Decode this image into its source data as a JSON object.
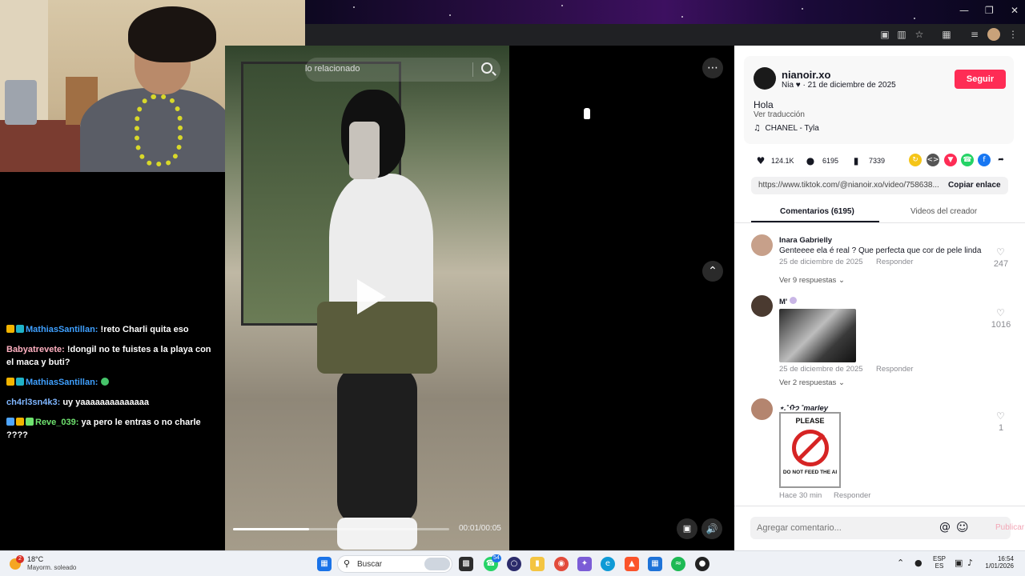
{
  "video_search": {
    "placeholder": "lo relacionado"
  },
  "video": {
    "time": "00:01/00:05",
    "progress": 0.35
  },
  "chat": {
    "messages": [
      {
        "user": "MathiasSantillan:",
        "text": "!reto Charli quita eso",
        "color": "#3fa0ff"
      },
      {
        "user": "Babyatrevete:",
        "text": "!dongil no te fuistes a la playa con el maca y buti?",
        "color": "#ffb0c0"
      },
      {
        "user": "MathiasSantillan:",
        "text": "",
        "color": "#3fa0ff"
      },
      {
        "user": "ch4rl3sn4k3:",
        "text": "uy yaaaaaaaaaaaaaa",
        "color": "#7fb6ff"
      },
      {
        "user": "Reve_039:",
        "text": "ya pero le entras o no charle ????",
        "color": "#6fe36f"
      }
    ]
  },
  "post": {
    "username": "nianoir.xo",
    "display_name": "Nia",
    "date": "21 de diciembre de 2025",
    "follow_label": "Seguir",
    "description": "Hola",
    "translate_label": "Ver traducción",
    "music": "CHANEL - Tyla",
    "likes": "124.1K",
    "comments": "6195",
    "saves": "7339",
    "link": "https://www.tiktok.com/@nianoir.xo/video/758638...",
    "copy_label": "Copiar enlace"
  },
  "tabs": {
    "comments": "Comentarios (6195)",
    "creator_videos": "Videos del creador"
  },
  "comments": [
    {
      "author": "Inara Gabrielly",
      "text": "Genteeee ela é real ? Que perfecta que cor de pele linda",
      "date": "25 de diciembre de 2025",
      "reply": "Responder",
      "likes": "247",
      "more": "Ver 9 respuestas"
    },
    {
      "author": "M'",
      "text": "",
      "date": "25 de diciembre de 2025",
      "reply": "Responder",
      "likes": "1016",
      "more": "Ver 2 respuestas"
    },
    {
      "author": "⋆.˚ᡣ𐭩 ˚marley",
      "text": "",
      "date": "Hace 30 min",
      "reply": "Responder",
      "likes": "1",
      "more": ""
    }
  ],
  "sticker": {
    "top": "PLEASE",
    "bottom": "DO NOT FEED THE AI"
  },
  "comment_input": {
    "placeholder": "Agregar comentario...",
    "publish": "Publicar"
  },
  "taskbar": {
    "weather_temp": "18°C",
    "weather_desc": "Mayorm. soleado",
    "search_label": "Buscar",
    "lang_top": "ESP",
    "lang_bottom": "ES",
    "time": "16:54",
    "date": "1/01/2026",
    "badge_count": "54",
    "weather_badge": "2"
  },
  "colors": {
    "tiktok_red": "#fe2c55",
    "taskbar": "#eef1f6"
  }
}
